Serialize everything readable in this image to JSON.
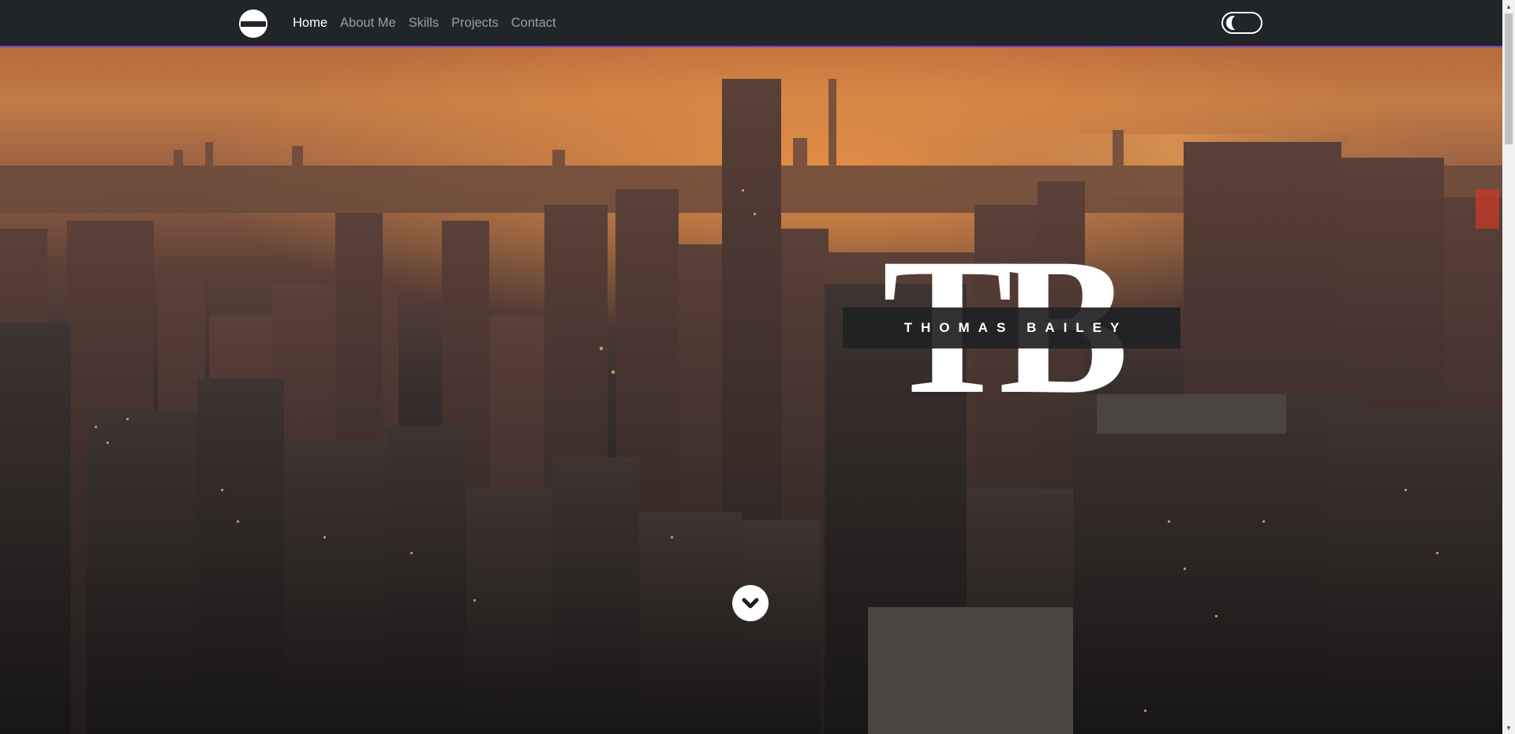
{
  "nav": {
    "logo_icon": "brand-logo-icon",
    "links": [
      {
        "label": "Home",
        "active": true
      },
      {
        "label": "About Me",
        "active": false
      },
      {
        "label": "Skills",
        "active": false
      },
      {
        "label": "Projects",
        "active": false
      },
      {
        "label": "Contact",
        "active": false
      }
    ],
    "theme_toggle_icon": "dark-mode-toggle-icon"
  },
  "hero": {
    "monogram": "TB",
    "name": "THOMAS BAILEY",
    "scroll_icon": "chevron-down-icon"
  },
  "colors": {
    "navbar_bg": "#212529",
    "navbar_border": "#6f42c1",
    "name_banner_bg": "#212123",
    "sunset_orange": "#c07a45"
  }
}
